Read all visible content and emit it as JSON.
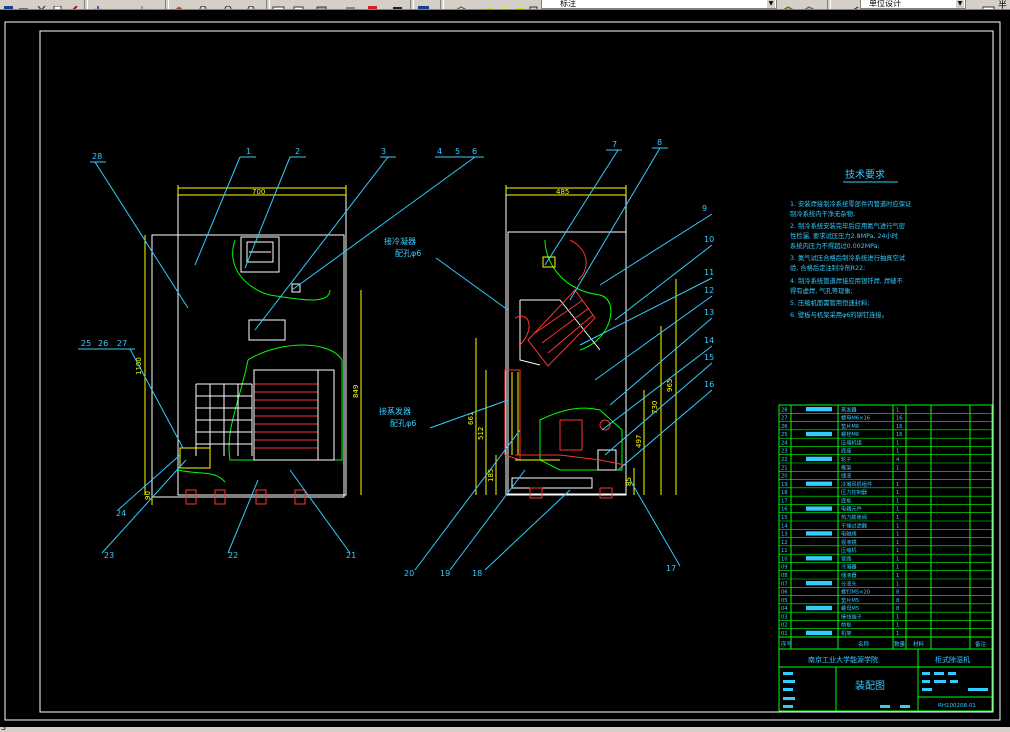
{
  "toolbar": {
    "layer_combo_value": "标注",
    "style_combo_value": "单位设计",
    "trailing_char": "半"
  },
  "status": {
    "fragment": "3"
  },
  "drawing": {
    "front_view": {
      "dims": {
        "width": "700",
        "height_left": "1100",
        "height_right": "849",
        "base": "90"
      },
      "leaders": [
        "1",
        "2",
        "3",
        "4",
        "5",
        "6",
        "28",
        "25",
        "26",
        "27",
        "24",
        "23",
        "22",
        "21"
      ]
    },
    "side_view": {
      "dims": {
        "width": "485",
        "v_965": "965",
        "v_730": "730",
        "v_497": "497",
        "v_661": "661",
        "v_512": "512",
        "v_185": "185",
        "v_85": "85"
      },
      "label_upper": "接冷凝器",
      "label_upper_sub": "配孔φ6",
      "label_lower": "接蒸发器",
      "label_lower_sub": "配孔φ6",
      "leaders": [
        "7",
        "8",
        "9",
        "10",
        "11",
        "12",
        "13",
        "14",
        "15",
        "16",
        "17",
        "18",
        "19",
        "20"
      ]
    },
    "tech_title": "技术要求",
    "tech_lines": [
      "1.  安装焊接制冷系统零部件内管道时应保证",
      "     制冷系统内干净无杂物;",
      "2.  制冷系统安装完毕后应用氮气进行气密",
      "     性检漏, 要求试压压力2.8MPa, 24小时",
      "     系统内压力不得超过0.002MPa;",
      "3.  氮气试压合格后制冷系统进行抽真空试",
      "     验, 合格后定注制冷剂R22;",
      "4.  制冷系统管道焊接应用银钎焊, 焊缝不",
      "     得有虚焊, 气孔等现象;",
      "5.  压缩机面需管用恒速封料;",
      "6.  壁板与机架采用φ6的铆钉连接。"
    ],
    "bom_rows": [
      {
        "no": "28",
        "name": "蒸发器",
        "qty": "1"
      },
      {
        "no": "27",
        "name": "螺母M6×16",
        "qty": "16"
      },
      {
        "no": "26",
        "name": "垫片M6",
        "qty": "16"
      },
      {
        "no": "25",
        "name": "螺栓M6",
        "qty": "16"
      },
      {
        "no": "24",
        "name": "压缩机组",
        "qty": "1"
      },
      {
        "no": "23",
        "name": "底座",
        "qty": "1"
      },
      {
        "no": "22",
        "name": "轮子",
        "qty": "4"
      },
      {
        "no": "21",
        "name": "框架",
        "qty": "1"
      },
      {
        "no": "20",
        "name": "储液",
        "qty": ""
      },
      {
        "no": "19",
        "name": "冷凝风机组件",
        "qty": "1"
      },
      {
        "no": "18",
        "name": "压力控制器",
        "qty": "1"
      },
      {
        "no": "17",
        "name": "底板",
        "qty": "1"
      },
      {
        "no": "16",
        "name": "电器元件",
        "qty": "1"
      },
      {
        "no": "15",
        "name": "热力膨胀阀",
        "qty": "1"
      },
      {
        "no": "14",
        "name": "干燥过滤器",
        "qty": "1"
      },
      {
        "no": "13",
        "name": "电磁阀",
        "qty": "1"
      },
      {
        "no": "12",
        "name": "视液镜",
        "qty": "1"
      },
      {
        "no": "11",
        "name": "压缩机",
        "qty": "1"
      },
      {
        "no": "10",
        "name": "管路",
        "qty": "1"
      },
      {
        "no": "09",
        "name": "冷凝器",
        "qty": "1"
      },
      {
        "no": "08",
        "name": "储液器",
        "qty": "1"
      },
      {
        "no": "07",
        "name": "分液头",
        "qty": "1"
      },
      {
        "no": "06",
        "name": "螺钉M5×20",
        "qty": "8"
      },
      {
        "no": "05",
        "name": "垫片M5",
        "qty": "8"
      },
      {
        "no": "04",
        "name": "螺母M5",
        "qty": "8"
      },
      {
        "no": "03",
        "name": "接线端子",
        "qty": "1"
      },
      {
        "no": "02",
        "name": "前板",
        "qty": "1"
      },
      {
        "no": "01",
        "name": "机架",
        "qty": "1"
      }
    ],
    "title_block": {
      "school": "南京工业大学能源学院",
      "product": "柜式除湿机",
      "drawing_name": "装配图",
      "drawing_no": "RH100208-01",
      "header_left": "序号",
      "header_name": "名称",
      "header_qty": "数量",
      "header_material": "材料",
      "header_note": "备注"
    }
  }
}
